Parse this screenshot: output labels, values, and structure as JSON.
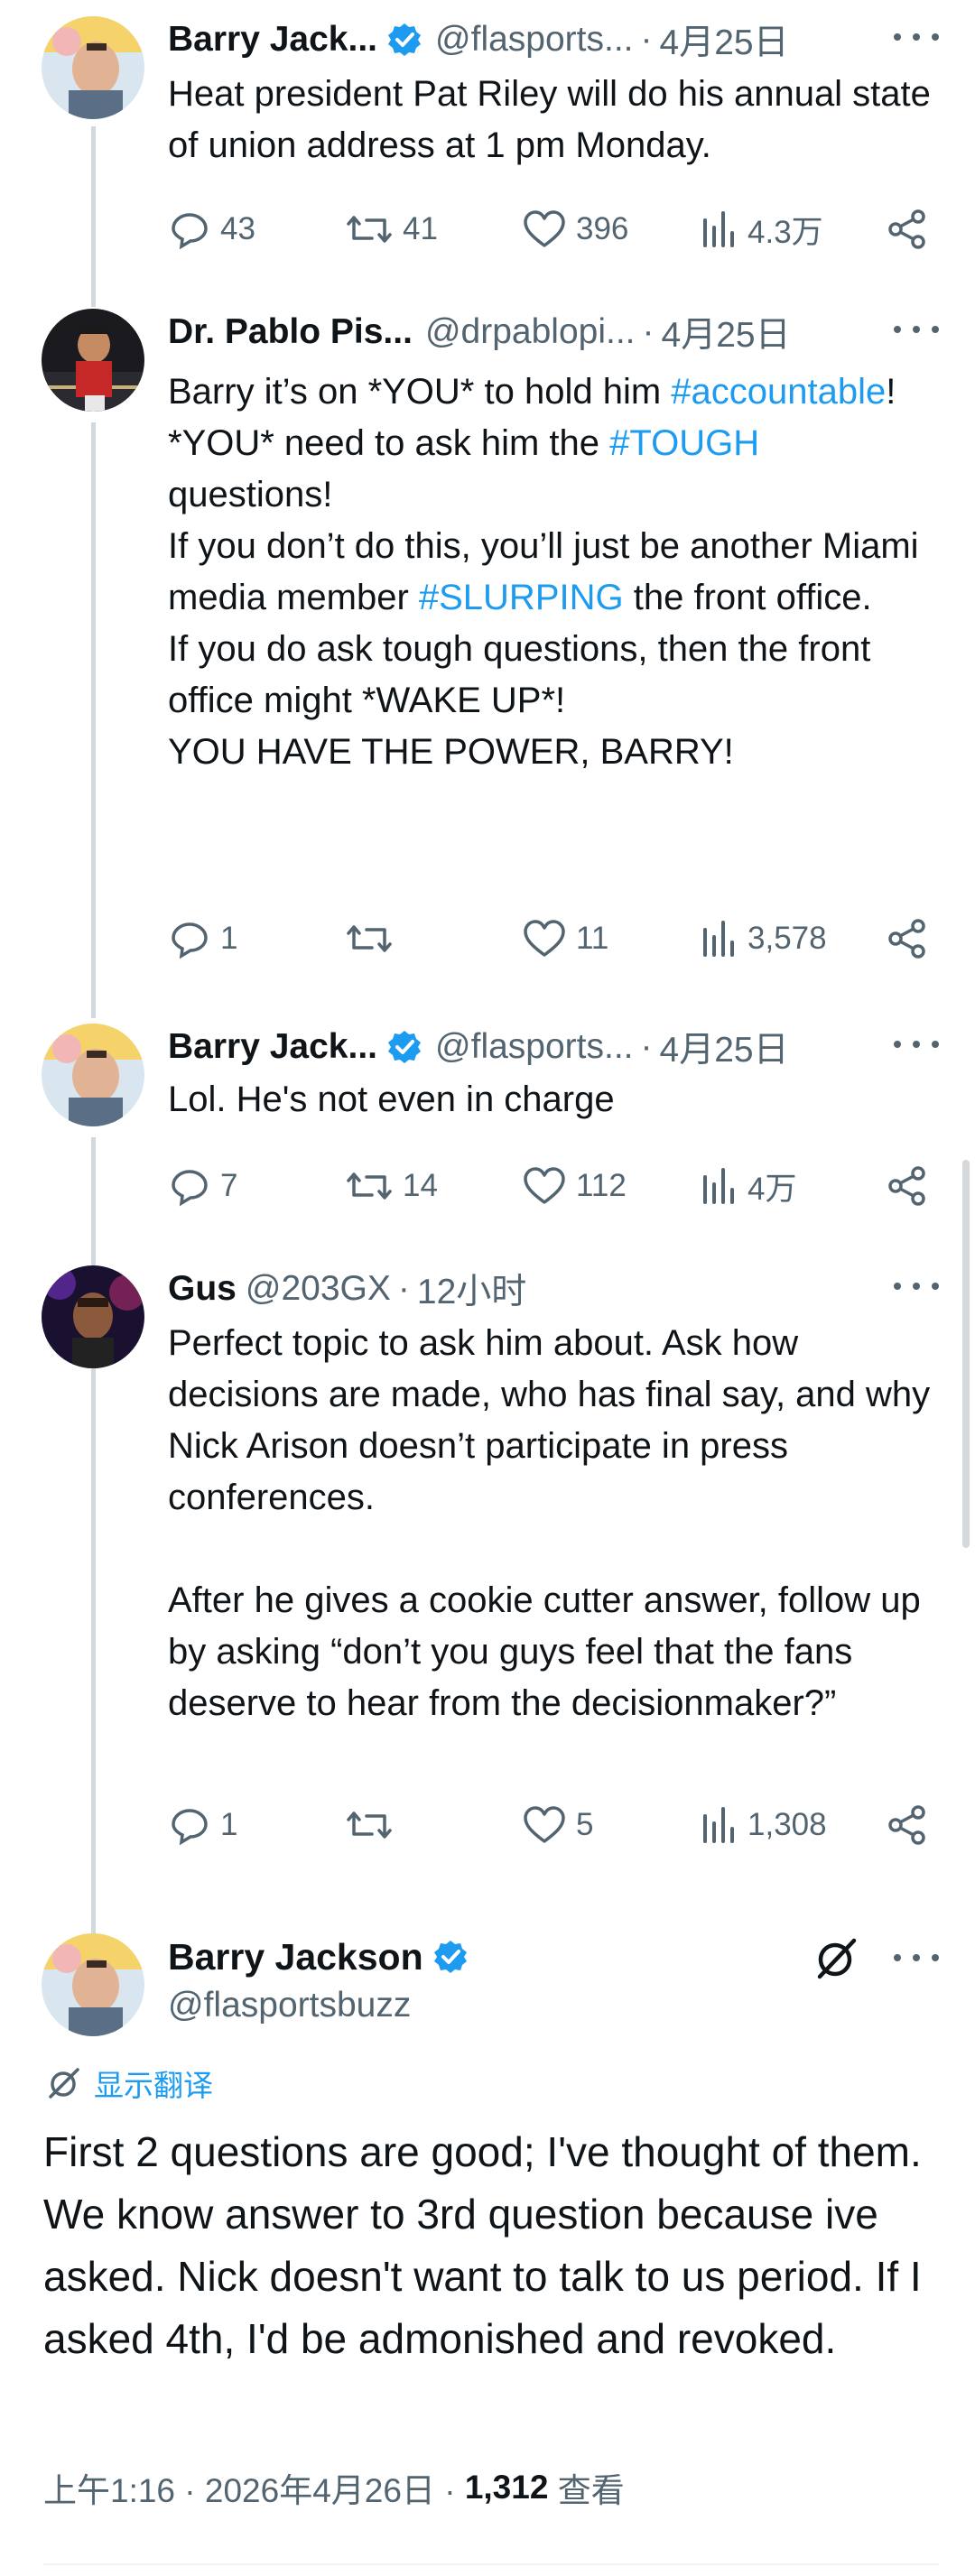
{
  "colors": {
    "accent": "#1d9bf0",
    "text": "#0f1419",
    "secondary": "#536471",
    "thread_line": "#cfd9de"
  },
  "replies": [
    {
      "name": "Barry Jack...",
      "verified": true,
      "handle": "@flasports...",
      "time": "4月25日",
      "text": "Heat president Pat Riley will do his annual state of union address at 1 pm Monday.",
      "stats": {
        "replies": "43",
        "reposts": "41",
        "likes": "396",
        "views": "4.3万"
      }
    },
    {
      "name": "Dr. Pablo Pis...",
      "verified": false,
      "handle": "@drpablopi...",
      "time": "4月25日",
      "text_parts": [
        "Barry it’s on *YOU* to hold him ",
        "#accountable",
        "!\n*YOU* need to ask him the ",
        "#TOUGH",
        "\nquestions!\nIf you don’t do this, you’ll just be another Miami media member ",
        "#SLURPING",
        " the front office.\nIf you do ask tough questions, then the front office might *WAKE UP*!\nYOU HAVE THE POWER, BARRY!"
      ],
      "stats": {
        "replies": "1",
        "reposts": "",
        "likes": "11",
        "views": "3,578"
      }
    },
    {
      "name": "Barry Jack...",
      "verified": true,
      "handle": "@flasports...",
      "time": "4月25日",
      "text": "Lol. He's not even in charge",
      "stats": {
        "replies": "7",
        "reposts": "14",
        "likes": "112",
        "views": "4万"
      }
    },
    {
      "name": "Gus",
      "verified": false,
      "handle": "@203GX",
      "time": "12小时",
      "text": "Perfect topic to ask him about. Ask how decisions are made, who has final say, and why Nick Arison doesn’t participate in press conferences.\n\nAfter he gives a cookie cutter answer, follow up by asking “don’t you guys feel that the fans deserve to hear from the decisionmaker?”",
      "stats": {
        "replies": "1",
        "reposts": "",
        "likes": "5",
        "views": "1,308"
      }
    }
  ],
  "main_tweet": {
    "name": "Barry Jackson",
    "verified": true,
    "handle": "@flasportsbuzz",
    "translate_label": "显示翻译",
    "text": "First 2 questions are good; I've thought of them. We know answer to 3rd question because ive asked. Nick doesn't want to talk to us period. If I asked 4th, I'd be admonished and revoked.",
    "timestamp": "上午1:16 · 2026年4月26日 · ",
    "views_count": "1,312",
    "views_label": " 查看"
  },
  "icons": [
    "reply-icon",
    "repost-icon",
    "like-icon",
    "views-icon",
    "share-icon",
    "more-icon",
    "verified-icon",
    "translate-icon",
    "grok-icon"
  ]
}
